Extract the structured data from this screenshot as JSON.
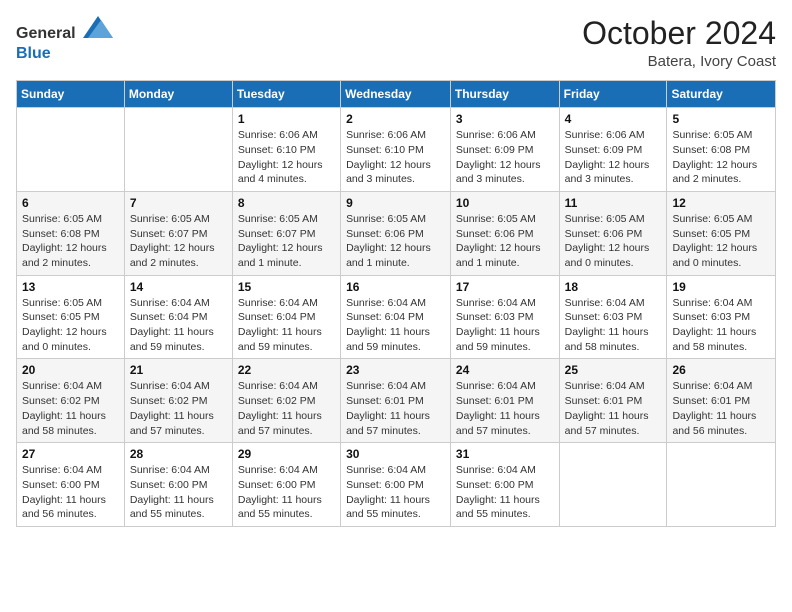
{
  "header": {
    "logo_general": "General",
    "logo_blue": "Blue",
    "month": "October 2024",
    "location": "Batera, Ivory Coast"
  },
  "weekdays": [
    "Sunday",
    "Monday",
    "Tuesday",
    "Wednesday",
    "Thursday",
    "Friday",
    "Saturday"
  ],
  "weeks": [
    [
      {
        "day": "",
        "sunrise": "",
        "sunset": "",
        "daylight": ""
      },
      {
        "day": "",
        "sunrise": "",
        "sunset": "",
        "daylight": ""
      },
      {
        "day": "1",
        "sunrise": "Sunrise: 6:06 AM",
        "sunset": "Sunset: 6:10 PM",
        "daylight": "Daylight: 12 hours and 4 minutes."
      },
      {
        "day": "2",
        "sunrise": "Sunrise: 6:06 AM",
        "sunset": "Sunset: 6:10 PM",
        "daylight": "Daylight: 12 hours and 3 minutes."
      },
      {
        "day": "3",
        "sunrise": "Sunrise: 6:06 AM",
        "sunset": "Sunset: 6:09 PM",
        "daylight": "Daylight: 12 hours and 3 minutes."
      },
      {
        "day": "4",
        "sunrise": "Sunrise: 6:06 AM",
        "sunset": "Sunset: 6:09 PM",
        "daylight": "Daylight: 12 hours and 3 minutes."
      },
      {
        "day": "5",
        "sunrise": "Sunrise: 6:05 AM",
        "sunset": "Sunset: 6:08 PM",
        "daylight": "Daylight: 12 hours and 2 minutes."
      }
    ],
    [
      {
        "day": "6",
        "sunrise": "Sunrise: 6:05 AM",
        "sunset": "Sunset: 6:08 PM",
        "daylight": "Daylight: 12 hours and 2 minutes."
      },
      {
        "day": "7",
        "sunrise": "Sunrise: 6:05 AM",
        "sunset": "Sunset: 6:07 PM",
        "daylight": "Daylight: 12 hours and 2 minutes."
      },
      {
        "day": "8",
        "sunrise": "Sunrise: 6:05 AM",
        "sunset": "Sunset: 6:07 PM",
        "daylight": "Daylight: 12 hours and 1 minute."
      },
      {
        "day": "9",
        "sunrise": "Sunrise: 6:05 AM",
        "sunset": "Sunset: 6:06 PM",
        "daylight": "Daylight: 12 hours and 1 minute."
      },
      {
        "day": "10",
        "sunrise": "Sunrise: 6:05 AM",
        "sunset": "Sunset: 6:06 PM",
        "daylight": "Daylight: 12 hours and 1 minute."
      },
      {
        "day": "11",
        "sunrise": "Sunrise: 6:05 AM",
        "sunset": "Sunset: 6:06 PM",
        "daylight": "Daylight: 12 hours and 0 minutes."
      },
      {
        "day": "12",
        "sunrise": "Sunrise: 6:05 AM",
        "sunset": "Sunset: 6:05 PM",
        "daylight": "Daylight: 12 hours and 0 minutes."
      }
    ],
    [
      {
        "day": "13",
        "sunrise": "Sunrise: 6:05 AM",
        "sunset": "Sunset: 6:05 PM",
        "daylight": "Daylight: 12 hours and 0 minutes."
      },
      {
        "day": "14",
        "sunrise": "Sunrise: 6:04 AM",
        "sunset": "Sunset: 6:04 PM",
        "daylight": "Daylight: 11 hours and 59 minutes."
      },
      {
        "day": "15",
        "sunrise": "Sunrise: 6:04 AM",
        "sunset": "Sunset: 6:04 PM",
        "daylight": "Daylight: 11 hours and 59 minutes."
      },
      {
        "day": "16",
        "sunrise": "Sunrise: 6:04 AM",
        "sunset": "Sunset: 6:04 PM",
        "daylight": "Daylight: 11 hours and 59 minutes."
      },
      {
        "day": "17",
        "sunrise": "Sunrise: 6:04 AM",
        "sunset": "Sunset: 6:03 PM",
        "daylight": "Daylight: 11 hours and 59 minutes."
      },
      {
        "day": "18",
        "sunrise": "Sunrise: 6:04 AM",
        "sunset": "Sunset: 6:03 PM",
        "daylight": "Daylight: 11 hours and 58 minutes."
      },
      {
        "day": "19",
        "sunrise": "Sunrise: 6:04 AM",
        "sunset": "Sunset: 6:03 PM",
        "daylight": "Daylight: 11 hours and 58 minutes."
      }
    ],
    [
      {
        "day": "20",
        "sunrise": "Sunrise: 6:04 AM",
        "sunset": "Sunset: 6:02 PM",
        "daylight": "Daylight: 11 hours and 58 minutes."
      },
      {
        "day": "21",
        "sunrise": "Sunrise: 6:04 AM",
        "sunset": "Sunset: 6:02 PM",
        "daylight": "Daylight: 11 hours and 57 minutes."
      },
      {
        "day": "22",
        "sunrise": "Sunrise: 6:04 AM",
        "sunset": "Sunset: 6:02 PM",
        "daylight": "Daylight: 11 hours and 57 minutes."
      },
      {
        "day": "23",
        "sunrise": "Sunrise: 6:04 AM",
        "sunset": "Sunset: 6:01 PM",
        "daylight": "Daylight: 11 hours and 57 minutes."
      },
      {
        "day": "24",
        "sunrise": "Sunrise: 6:04 AM",
        "sunset": "Sunset: 6:01 PM",
        "daylight": "Daylight: 11 hours and 57 minutes."
      },
      {
        "day": "25",
        "sunrise": "Sunrise: 6:04 AM",
        "sunset": "Sunset: 6:01 PM",
        "daylight": "Daylight: 11 hours and 57 minutes."
      },
      {
        "day": "26",
        "sunrise": "Sunrise: 6:04 AM",
        "sunset": "Sunset: 6:01 PM",
        "daylight": "Daylight: 11 hours and 56 minutes."
      }
    ],
    [
      {
        "day": "27",
        "sunrise": "Sunrise: 6:04 AM",
        "sunset": "Sunset: 6:00 PM",
        "daylight": "Daylight: 11 hours and 56 minutes."
      },
      {
        "day": "28",
        "sunrise": "Sunrise: 6:04 AM",
        "sunset": "Sunset: 6:00 PM",
        "daylight": "Daylight: 11 hours and 55 minutes."
      },
      {
        "day": "29",
        "sunrise": "Sunrise: 6:04 AM",
        "sunset": "Sunset: 6:00 PM",
        "daylight": "Daylight: 11 hours and 55 minutes."
      },
      {
        "day": "30",
        "sunrise": "Sunrise: 6:04 AM",
        "sunset": "Sunset: 6:00 PM",
        "daylight": "Daylight: 11 hours and 55 minutes."
      },
      {
        "day": "31",
        "sunrise": "Sunrise: 6:04 AM",
        "sunset": "Sunset: 6:00 PM",
        "daylight": "Daylight: 11 hours and 55 minutes."
      },
      {
        "day": "",
        "sunrise": "",
        "sunset": "",
        "daylight": ""
      },
      {
        "day": "",
        "sunrise": "",
        "sunset": "",
        "daylight": ""
      }
    ]
  ]
}
